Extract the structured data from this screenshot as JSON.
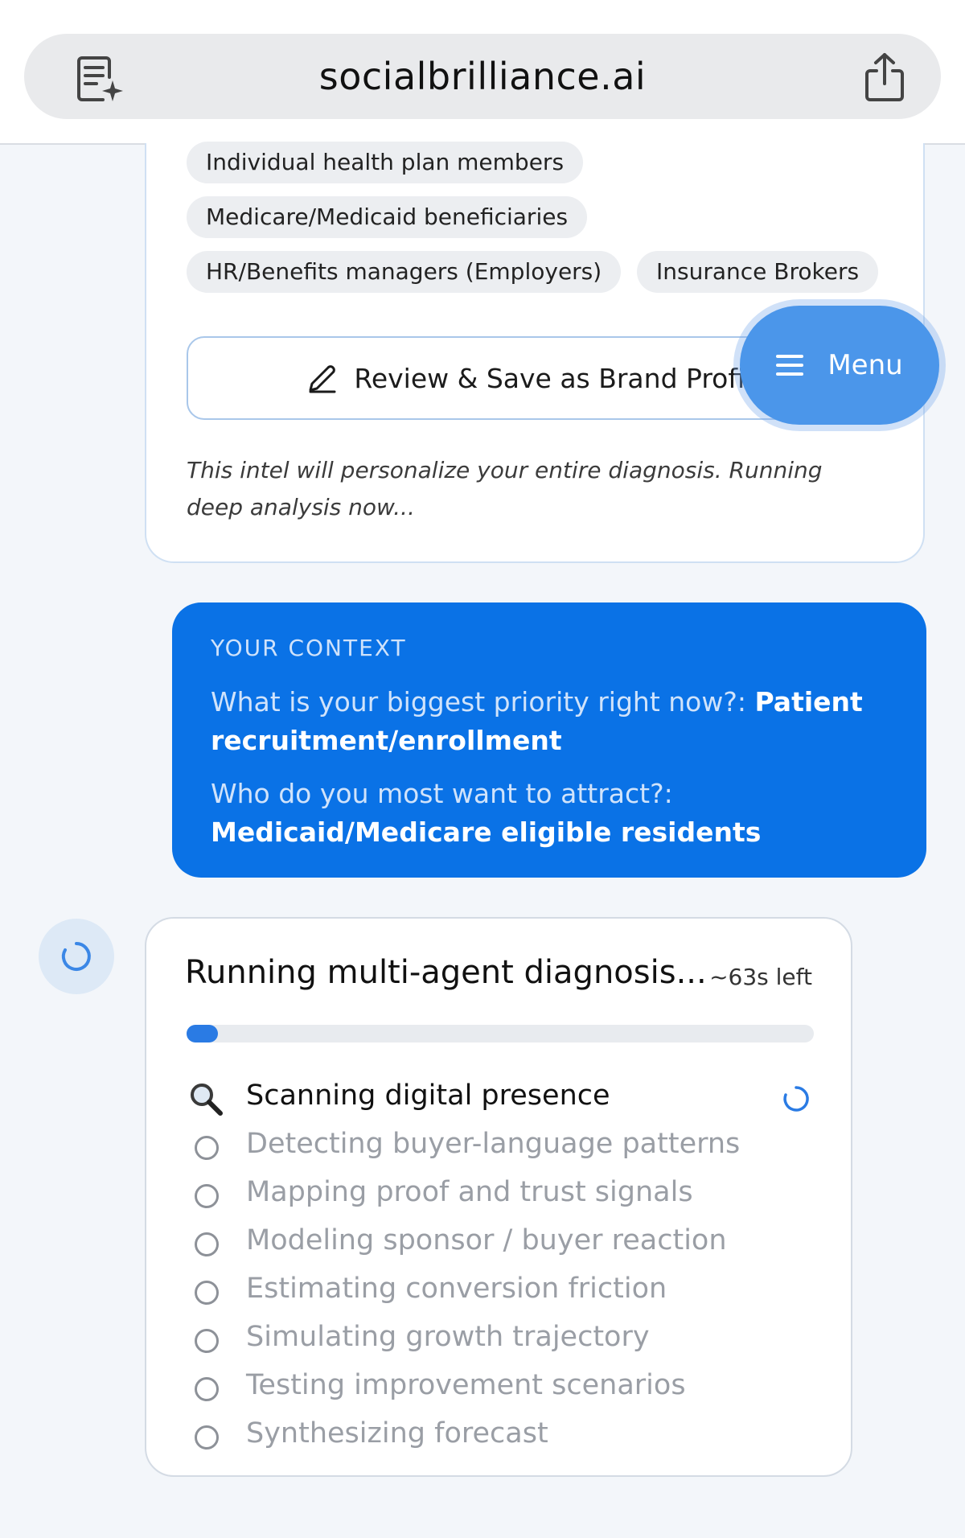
{
  "browser": {
    "url": "socialbrilliance.ai",
    "page_icon": "page-sparkle-icon",
    "share_icon": "share-icon"
  },
  "profile_card": {
    "chips": [
      "Individual health plan members",
      "Medicare/Medicaid beneficiaries",
      "HR/Benefits managers (Employers)",
      "Insurance Brokers"
    ],
    "review_button": "Review & Save as Brand Profile",
    "note": "This intel will personalize your entire diagnosis. Running deep analysis now..."
  },
  "menu": {
    "label": "Menu"
  },
  "context": {
    "title": "YOUR CONTEXT",
    "q1": "What is your biggest priority right now?:",
    "a1": "Patient recruitment/enrollment",
    "q2": "Who do you most want to attract?:",
    "a2": "Medicaid/Medicare eligible residents"
  },
  "diagnosis": {
    "title": "Running multi-agent diagnosis...",
    "time_left": "~63s left",
    "progress": 0.05,
    "steps": [
      "Scanning digital presence",
      "Detecting buyer-language patterns",
      "Mapping proof and trust signals",
      "Modeling sponsor / buyer reaction",
      "Estimating conversion friction",
      "Simulating growth trajectory",
      "Testing improvement scenarios",
      "Synthesizing forecast"
    ],
    "active_step": 0
  },
  "colors": {
    "accent": "#0a72e6",
    "menu": "#4b96ea",
    "progress": "#2a7be4"
  }
}
